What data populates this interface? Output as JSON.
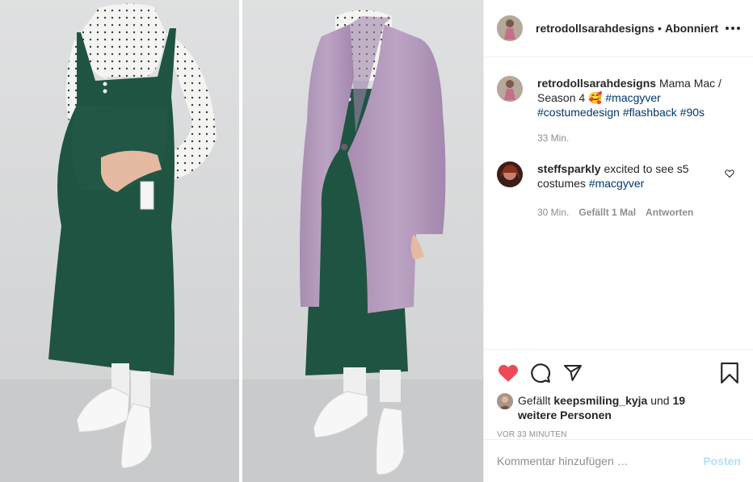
{
  "header": {
    "username": "retrodollsarahdesigns",
    "separator": "•",
    "follow_status": "Abonniert"
  },
  "caption": {
    "username": "retrodollsarahdesigns",
    "text": "Mama Mac / Season 4 🥰",
    "hashtags": [
      "#macgyver",
      "#costumedesign",
      "#flashback",
      "#90s"
    ],
    "time": "33 Min."
  },
  "comments": [
    {
      "username": "steffsparkly",
      "text": "excited to see s5 costumes",
      "hashtag": "#macgyver",
      "time": "30 Min.",
      "likes": "Gefällt 1 Mal",
      "reply": "Antworten"
    }
  ],
  "likes": {
    "prefix": "Gefällt",
    "user": "keepsmiling_kyja",
    "conj": "und",
    "others": "19 weitere Personen"
  },
  "timestamp": "VOR 33 MINUTEN",
  "add_comment": {
    "placeholder": "Kommentar hinzufügen …",
    "post_label": "Posten"
  },
  "colors": {
    "like_red": "#ed4956",
    "link_blue": "#00376b",
    "muted": "#8e8e8e",
    "post_disabled": "#b2dffc",
    "coat": "#b59bbd",
    "dress": "#1e5240"
  },
  "icons": [
    "heart-filled-icon",
    "comment-icon",
    "share-icon",
    "bookmark-icon",
    "more-icon",
    "heart-outline-icon"
  ]
}
